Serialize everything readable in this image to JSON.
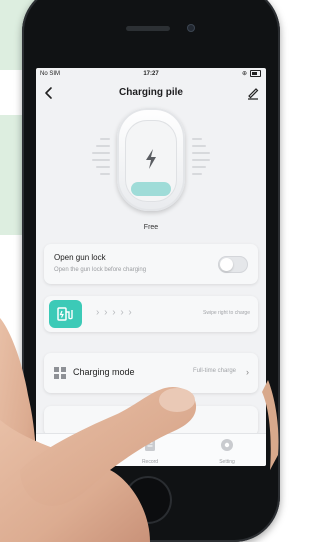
{
  "status_bar": {
    "carrier": "No SIM",
    "time": "17:27"
  },
  "header": {
    "title": "Charging pile"
  },
  "pile": {
    "status": "Free"
  },
  "gun_lock": {
    "title": "Open gun lock",
    "subtitle": "Open the gun lock before charging",
    "enabled": false
  },
  "swipe": {
    "arrows": "› › › › ›",
    "hint": "Swipe right to charge"
  },
  "charging_mode": {
    "label": "Charging mode",
    "value": "Full-time charge"
  },
  "tabbar": {
    "record_label": "Record",
    "setting_label": "Setting"
  },
  "colors": {
    "accent": "#3ccab7",
    "level": "#9fdcd8",
    "background_panel": "#ddeee0"
  }
}
